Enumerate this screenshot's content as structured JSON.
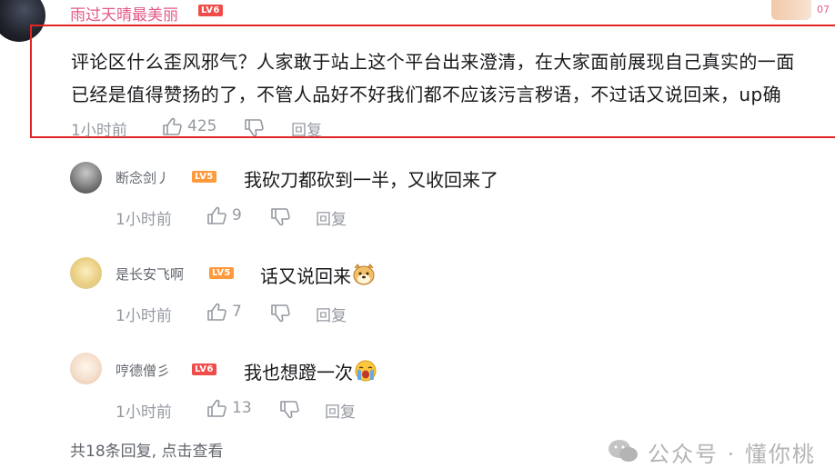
{
  "top_comment": {
    "username": "雨过天晴最美丽",
    "level": "LV6",
    "corner_text": "07",
    "lines": [
      "评论区什么歪风邪气？人家敢于站上这个平台出来澄清，在大家面前展现自己真实的一面",
      "已经是值得赞扬的了，不管人品好不好我们都不应该污言秽语，不过话又说回来，up确"
    ],
    "time": "1小时前",
    "likes": "425",
    "reply_label": "回复"
  },
  "replies": [
    {
      "username": "断念剑丿",
      "level": "LV5",
      "text": "我砍刀都砍到一半，又收回来了",
      "time": "1小时前",
      "likes": "9",
      "reply_label": "回复"
    },
    {
      "username": "是长安飞啊",
      "level": "LV5",
      "text": "话又说回来",
      "emoji": "doge-emoji",
      "time": "1小时前",
      "likes": "7",
      "reply_label": "回复"
    },
    {
      "username": "哼德僧彡",
      "level": "LV6",
      "text": "我也想蹬一次",
      "emoji": "crying-emoji",
      "time": "1小时前",
      "likes": "13",
      "reply_label": "回复"
    }
  ],
  "footer": {
    "more_replies": "共18条回复, 点击查看",
    "watermark": "公众号 · 懂你桃"
  },
  "colors": {
    "username_pink": "#e25a86",
    "highlight_red": "#e32424",
    "meta_gray": "#9499a0",
    "lv6": "#f04c49",
    "lv5": "#ff9a3c"
  }
}
